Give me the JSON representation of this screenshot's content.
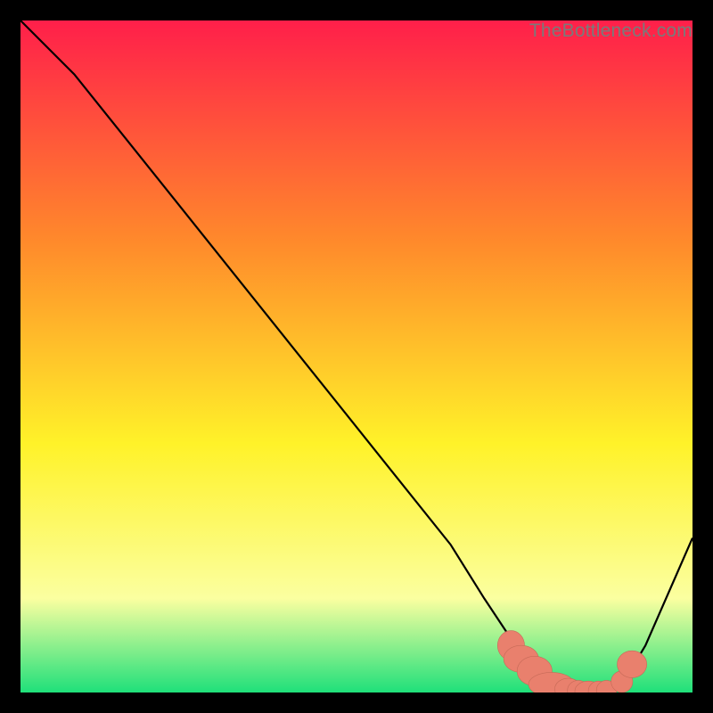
{
  "watermark": "TheBottleneck.com",
  "colors": {
    "red": "#ff1f4a",
    "orange": "#ff8a2b",
    "yellow": "#fff229",
    "paleyellow": "#fbffa0",
    "green": "#1fe07a",
    "line": "#000000",
    "marker_fill": "#e9806d",
    "marker_stroke": "#c76a58"
  },
  "chart_data": {
    "type": "line",
    "title": "",
    "xlabel": "",
    "ylabel": "",
    "xlim": [
      0,
      100
    ],
    "ylim": [
      0,
      100
    ],
    "series": [
      {
        "name": "bottleneck-curve",
        "x": [
          0,
          3,
          8,
          24,
          40,
          56,
          64,
          69,
          73,
          76,
          80,
          84,
          87,
          90,
          93,
          100
        ],
        "y": [
          100,
          97,
          92,
          72,
          52,
          32,
          22,
          14,
          8,
          4,
          1,
          0,
          0,
          2,
          7,
          23
        ]
      }
    ],
    "markers": [
      {
        "x": 73,
        "y": 7,
        "rx": 2.0,
        "ry": 2.2
      },
      {
        "x": 74.5,
        "y": 5,
        "rx": 2.6,
        "ry": 2.0
      },
      {
        "x": 76.5,
        "y": 3.2,
        "rx": 2.6,
        "ry": 2.2
      },
      {
        "x": 79,
        "y": 1.2,
        "rx": 3.4,
        "ry": 1.8
      },
      {
        "x": 81.5,
        "y": 0.5,
        "rx": 2.0,
        "ry": 1.6
      },
      {
        "x": 83,
        "y": 0.3,
        "rx": 1.6,
        "ry": 1.5
      },
      {
        "x": 84.5,
        "y": 0.2,
        "rx": 2.0,
        "ry": 1.5
      },
      {
        "x": 86,
        "y": 0.2,
        "rx": 1.5,
        "ry": 1.5
      },
      {
        "x": 87.2,
        "y": 0.3,
        "rx": 1.5,
        "ry": 1.5
      },
      {
        "x": 89.5,
        "y": 1.6,
        "rx": 1.6,
        "ry": 1.6
      },
      {
        "x": 91,
        "y": 4.2,
        "rx": 2.2,
        "ry": 2.0
      }
    ]
  }
}
